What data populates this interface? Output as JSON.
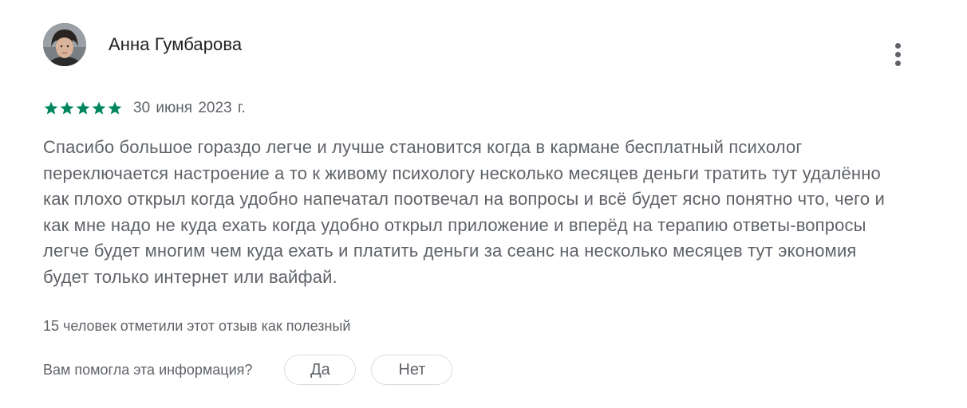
{
  "review": {
    "author": "Анна Гумбарова",
    "rating": 5,
    "rating_max": 5,
    "date": "30 июня 2023 г.",
    "text": "Спасибо большое гораздо легче и лучше становится когда в кармане бесплатный психолог переключается настроение а то к живому психологу несколько месяцев деньги тратить тут удалённо как плохо открыл когда удобно напечатал поотвечал на вопросы и всё будет ясно понятно что, чего и как мне надо не куда ехать когда удобно открыл приложение и вперёд на терапию ответы-вопросы легче будет многим чем куда ехать и платить деньги за сеанс на несколько месяцев тут экономия будет только интернет или вайфай.",
    "helpful_count_text": "15 человек отметили этот отзыв как полезный"
  },
  "feedback": {
    "question": "Вам помогла эта информация?",
    "yes_label": "Да",
    "no_label": "Нет"
  },
  "icons": {
    "star": "star-icon",
    "more": "more-vert-icon",
    "avatar": "user-avatar"
  },
  "colors": {
    "star_fill": "#01875f",
    "text_primary": "#202124",
    "text_secondary": "#5f6368",
    "button_border": "#dadce0"
  }
}
